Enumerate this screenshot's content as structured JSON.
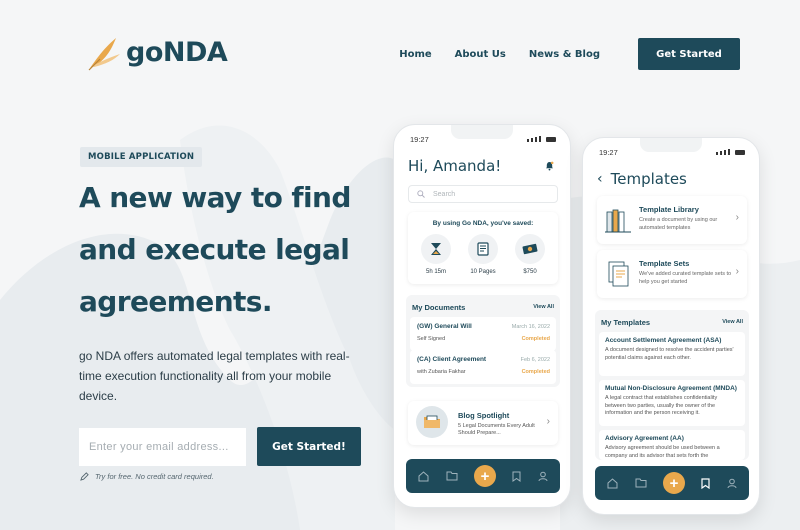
{
  "brand": {
    "name": "goNDA",
    "logo_icon": "feather-quill-icon",
    "accent": "#e9a84c",
    "primary": "#1e4a5a"
  },
  "nav": {
    "items": [
      "Home",
      "About Us",
      "News & Blog"
    ],
    "cta": "Get Started"
  },
  "hero": {
    "badge": "MOBILE APPLICATION",
    "headline_lines": [
      "A new way to find",
      "and execute legal",
      "agreements."
    ],
    "lead": "go NDA offers automated legal templates with real-time execution functionality all from your mobile device.",
    "email_placeholder": "Enter your email address...",
    "submit": "Get Started!",
    "note": "Try for free. No credit card required."
  },
  "phone1": {
    "time": "19:27",
    "greeting": "Hi, Amanda!",
    "search_placeholder": "Search",
    "saved_title": "By using Go NDA, you've saved:",
    "stats": [
      {
        "icon": "hourglass-icon",
        "value": "5h 15m"
      },
      {
        "icon": "document-icon",
        "value": "10 Pages"
      },
      {
        "icon": "money-icon",
        "value": "$750"
      }
    ],
    "docs_title": "My Documents",
    "view_all": "View All",
    "documents": [
      {
        "title": "(GW) General Will",
        "sub": "Self Signed",
        "date": "March 16, 2022",
        "status": "Completed"
      },
      {
        "title": "(CA) Client Agreement",
        "sub": "with Zubaria Fakhar",
        "date": "Feb 6, 2022",
        "status": "Completed"
      }
    ],
    "blog": {
      "title": "Blog Spotlight",
      "sub": "5 Legal Documents Every Adult Should Prepare..."
    }
  },
  "phone2": {
    "time": "19:27",
    "title": "Templates",
    "cards": [
      {
        "title": "Template Library",
        "sub": "Create a document by using our automated templates"
      },
      {
        "title": "Template Sets",
        "sub": "We've added curated template sets to help you get started"
      }
    ],
    "my_templates_title": "My Templates",
    "view_all": "View All",
    "templates": [
      {
        "title": "Account Settlement Agreement (ASA)",
        "sub": "A document designed to resolve the accident parties' potential claims against each other."
      },
      {
        "title": "Mutual Non-Disclosure Agreement (MNDA)",
        "sub": "A legal contract that establishes confidentiality between two parties, usually the owner of the information and the person receiving it."
      },
      {
        "title": "Advisory Agreement (AA)",
        "sub": "Advisory agreement should be used between a company and its advisor that sets forth the"
      }
    ]
  }
}
